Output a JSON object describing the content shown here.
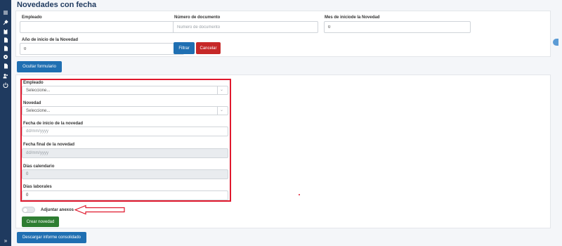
{
  "page": {
    "title": "Novedades con fecha"
  },
  "sidebar": {
    "icons": [
      "menu-icon",
      "tools-icon",
      "clipboard-icon",
      "document-icon",
      "document-icon",
      "gear-icon",
      "document-icon",
      "users-icon",
      "power-icon"
    ],
    "expand": "»"
  },
  "filters": {
    "empleado_label": "Empleado",
    "empleado_value": "",
    "documento_label": "Número de documento",
    "documento_placeholder": "Número de documento",
    "mes_label": "Mes de iniciode la Novedad",
    "mes_value": "0",
    "anio_label": "Año de inicio de la Novedad",
    "anio_value": "0",
    "filtrar_label": "Filtrar",
    "cancelar_label": "Cancelar"
  },
  "toggle_form_button": "Ocultar formulario",
  "form": {
    "empleado_label": "Empleado",
    "empleado_select": "Seleccione...",
    "novedad_label": "Novedad",
    "novedad_select": "Seleccione...",
    "fecha_inicio_label": "Fecha de inicio de la novedad",
    "fecha_inicio_placeholder": "dd/mm/yyyy",
    "fecha_final_label": "Fecha final de la novedad",
    "fecha_final_placeholder": "dd/mm/yyyy",
    "dias_calendario_label": "Días calendario",
    "dias_calendario_value": "0",
    "dias_laborales_label": "Días laborales",
    "dias_laborales_value": "0",
    "adjuntar_label": "Adjuntar anexos",
    "adjuntar_enabled": false,
    "crear_label": "Crear novedad"
  },
  "download_button": "Descargar informe consolidado",
  "colors": {
    "primary": "#1f6fb2",
    "danger": "#c62828",
    "success": "#2e7d32",
    "highlight": "#e0182d",
    "sidebar": "#1f3a5f"
  }
}
